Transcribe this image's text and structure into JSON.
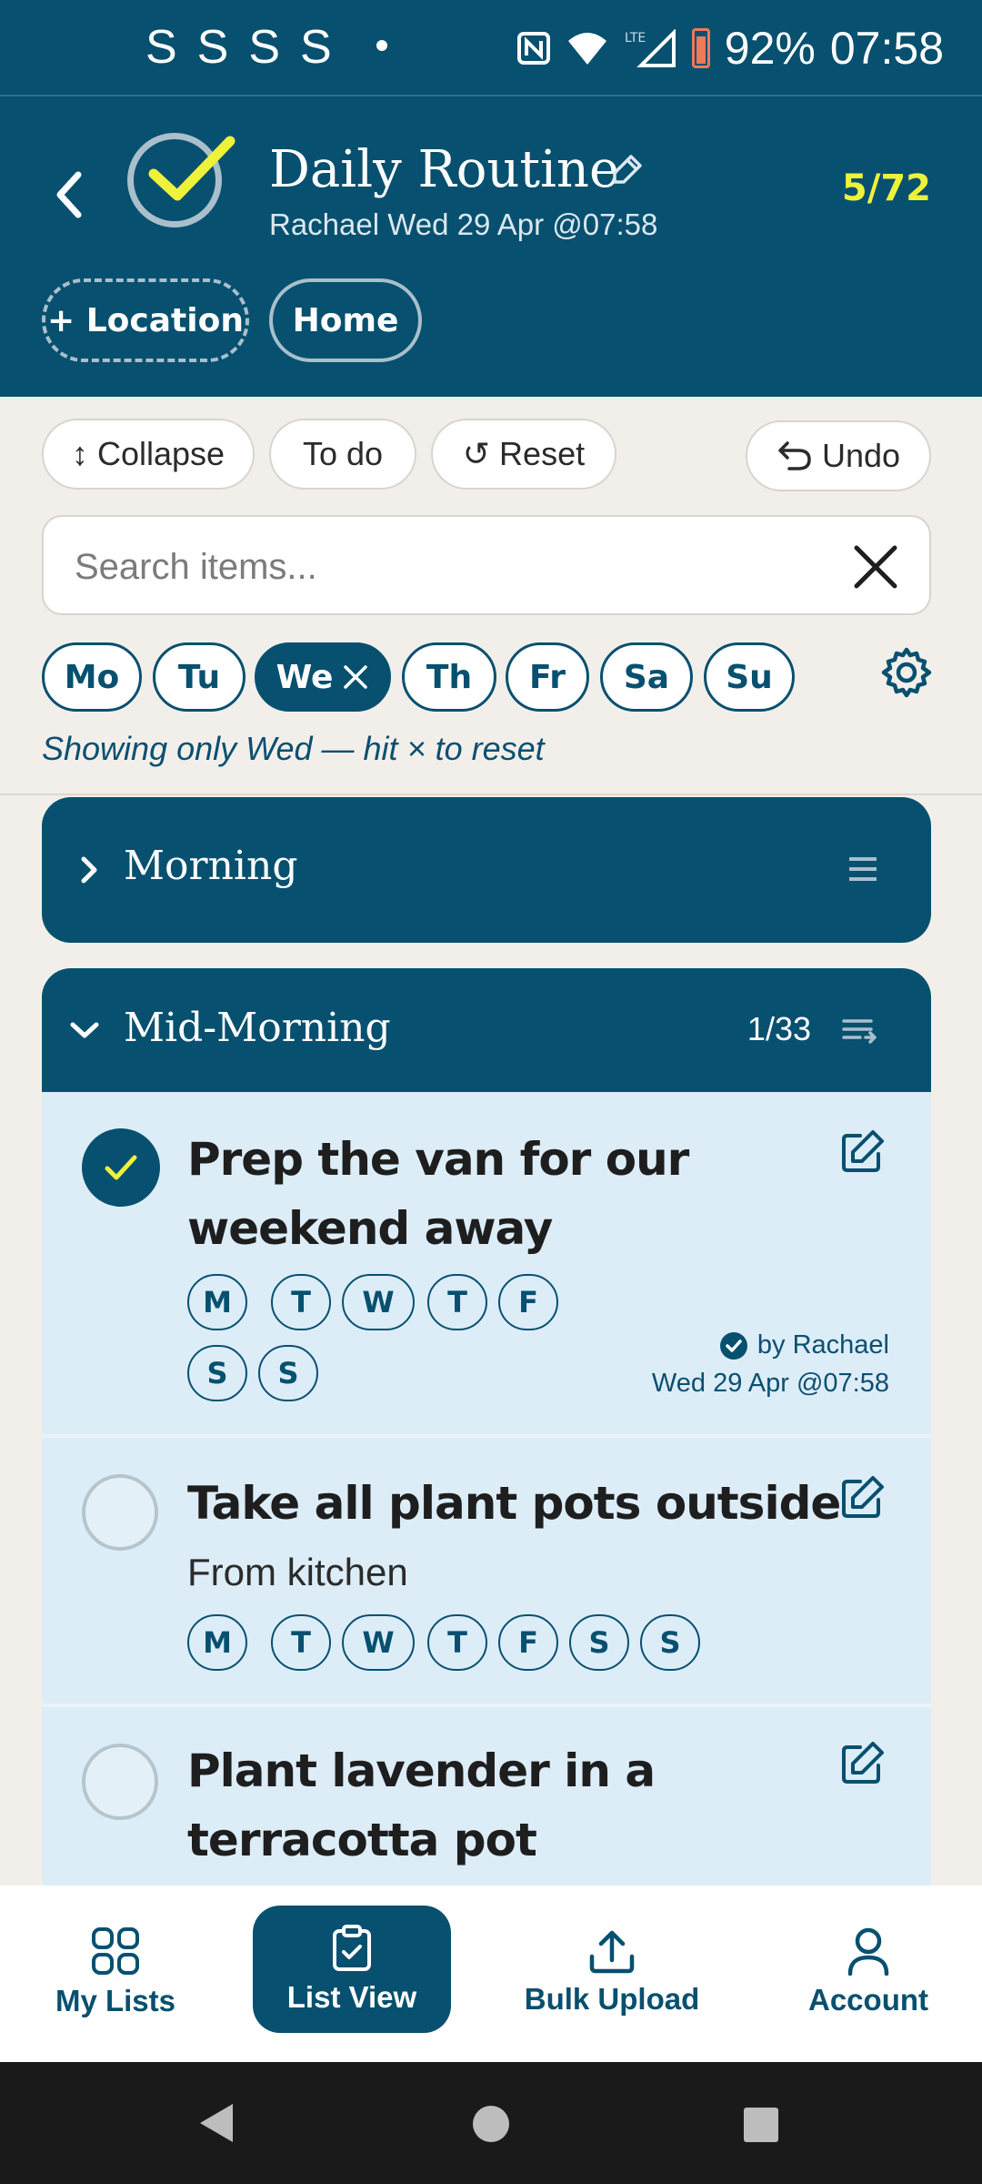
{
  "status_bar": {
    "notifications": "SSSS",
    "battery": "92%",
    "time": "07:58"
  },
  "header": {
    "title": "Daily Routine",
    "subtitle": "Rachael Wed 29 Apr @07:58",
    "counter": "5/72",
    "location_button": "+ Location",
    "home_button": "Home"
  },
  "toolbar": {
    "collapse": "↕ Collapse",
    "todo": "To do",
    "reset": "↺ Reset",
    "undo": "Undo"
  },
  "search": {
    "placeholder": "Search items..."
  },
  "days": [
    {
      "label": "Mo",
      "active": false
    },
    {
      "label": "Tu",
      "active": false
    },
    {
      "label": "We",
      "active": true
    },
    {
      "label": "Th",
      "active": false
    },
    {
      "label": "Fr",
      "active": false
    },
    {
      "label": "Sa",
      "active": false
    },
    {
      "label": "Su",
      "active": false
    }
  ],
  "filter_note": "Showing only Wed — hit × to reset",
  "sections": {
    "morning": {
      "title": "Morning",
      "expanded": false
    },
    "mid_morning": {
      "title": "Mid-Morning",
      "count": "1/33",
      "expanded": true
    }
  },
  "items": [
    {
      "title_line1": "Prep the van for our",
      "title_line2": "weekend away",
      "done": true,
      "days": [
        "M",
        "T",
        "W",
        "T",
        "F",
        "S",
        "S"
      ],
      "by": "by Rachael",
      "when": "Wed 29 Apr @07:58"
    },
    {
      "title_line1": "Take all plant pots outside",
      "subtitle": "From kitchen",
      "done": false,
      "days": [
        "M",
        "T",
        "W",
        "T",
        "F",
        "S",
        "S"
      ]
    },
    {
      "title_line1": "Plant lavender in a",
      "title_line2": "terracotta pot",
      "done": false
    }
  ],
  "bottom_nav": {
    "my_lists": "My Lists",
    "list_view": "List View",
    "bulk_upload": "Bulk Upload",
    "account": "Account"
  },
  "colors": {
    "primary": "#07506f",
    "accent": "#eef23a",
    "item_bg": "#dcedf8",
    "page_bg": "#f2efea"
  }
}
